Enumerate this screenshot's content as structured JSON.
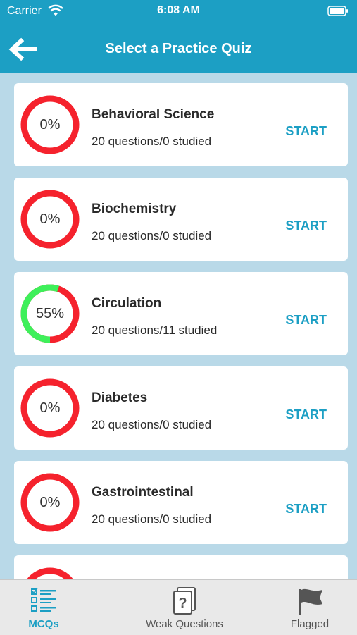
{
  "status_bar": {
    "carrier": "Carrier",
    "time": "6:08 AM"
  },
  "header": {
    "title": "Select a Practice Quiz",
    "back_icon": "back-arrow-icon"
  },
  "quizzes": [
    {
      "name": "Behavioral Science",
      "summary": "20 questions/0 studied",
      "percent_label": "0%",
      "progress": 0,
      "action": "START"
    },
    {
      "name": "Biochemistry",
      "summary": "20 questions/0 studied",
      "percent_label": "0%",
      "progress": 0,
      "action": "START"
    },
    {
      "name": "Circulation",
      "summary": "20 questions/11 studied",
      "percent_label": "55%",
      "progress": 0.55,
      "action": "START"
    },
    {
      "name": "Diabetes",
      "summary": "20 questions/0 studied",
      "percent_label": "0%",
      "progress": 0,
      "action": "START"
    },
    {
      "name": "Gastrointestinal",
      "summary": "20 questions/0 studied",
      "percent_label": "0%",
      "progress": 0,
      "action": "START"
    }
  ],
  "tabs": [
    {
      "label": "MCQs",
      "icon": "mcq-list-icon",
      "active": true
    },
    {
      "label": "Weak Questions",
      "icon": "weak-questions-icon",
      "active": false
    },
    {
      "label": "Flagged",
      "icon": "flag-icon",
      "active": false
    }
  ],
  "colors": {
    "accent": "#1c9fc4",
    "ring_remaining": "#f5222d",
    "ring_done": "#3ef05a",
    "background": "#b9d9e8"
  }
}
